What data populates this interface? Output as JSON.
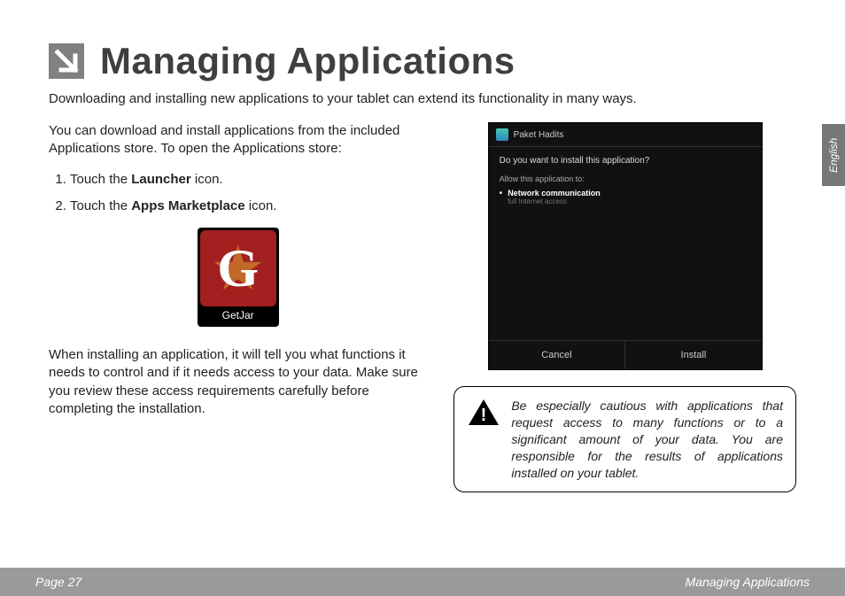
{
  "header": {
    "title": "Managing Applications"
  },
  "intro": "Downloading and installing new applications to your tablet can extend its functionality in many ways.",
  "left": {
    "lead": "You can download and install applications from the included Applications store. To open the Applications store:",
    "steps_prefix": [
      "Touch the ",
      "Touch the "
    ],
    "steps_bold": [
      "Launcher",
      "Apps Marketplace"
    ],
    "steps_suffix": [
      " icon.",
      " icon."
    ],
    "getjar_label": "GetJar",
    "install_note": "When installing an application, it will tell you what functions it needs to control and if it needs access to your data. Make sure you review these access requirements carefully before completing the installation."
  },
  "screenshot": {
    "app_name": "Paket Hadits",
    "question": "Do you want to install this application?",
    "allow": "Allow this application to:",
    "perm_title": "Network communication",
    "perm_sub": "full Internet access",
    "cancel": "Cancel",
    "install": "Install"
  },
  "caution": "Be especially cautious with applications that request access to many functions or to a significant amount of your data. You are responsible for the results of applications installed on your tablet.",
  "lang_tab": "English",
  "footer": {
    "page": "Page 27",
    "section": "Managing Applications"
  }
}
